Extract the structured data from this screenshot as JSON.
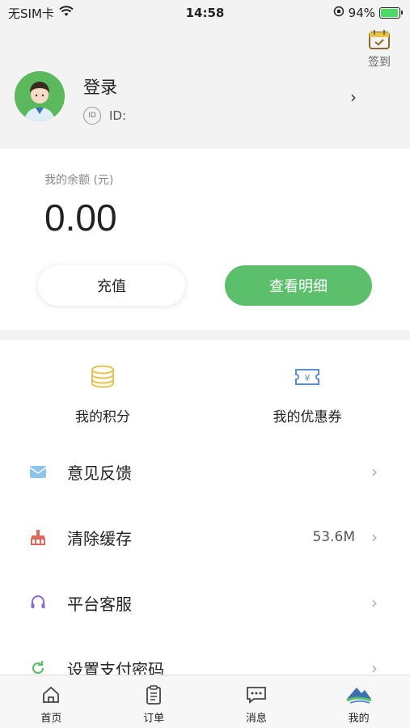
{
  "status_bar": {
    "carrier": "无SIM卡",
    "time": "14:58",
    "battery_pct": "94%",
    "battery_level": 0.94
  },
  "header": {
    "checkin_label": "签到",
    "login_label": "登录",
    "id_badge": "ID",
    "id_label": "ID:",
    "arrow": "›"
  },
  "balance": {
    "label": "我的余额 (元)",
    "value": "0.00",
    "recharge_button": "充值",
    "detail_button": "查看明细"
  },
  "quick": {
    "points_label": "我的积分",
    "coupons_label": "我的优惠券",
    "coupon_symbol": "¥"
  },
  "menu": [
    {
      "label": "意见反馈",
      "value": "",
      "icon": "envelope-icon"
    },
    {
      "label": "清除缓存",
      "value": "53.6M",
      "icon": "broom-icon"
    },
    {
      "label": "平台客服",
      "value": "",
      "icon": "headset-icon"
    },
    {
      "label": "设置支付密码",
      "value": "",
      "icon": "refresh-icon"
    }
  ],
  "menu_arrow": "›",
  "tabbar": [
    {
      "label": "首页",
      "icon": "home-icon"
    },
    {
      "label": "订单",
      "icon": "clipboard-icon"
    },
    {
      "label": "消息",
      "icon": "message-icon"
    },
    {
      "label": "我的",
      "icon": "profile-logo-icon"
    }
  ],
  "colors": {
    "accent_green": "#5cbf6b",
    "points_gold": "#e6c34a",
    "coupon_blue": "#5a8fd6",
    "cache_red": "#e06a5a",
    "service_purple": "#8a6ad6"
  }
}
